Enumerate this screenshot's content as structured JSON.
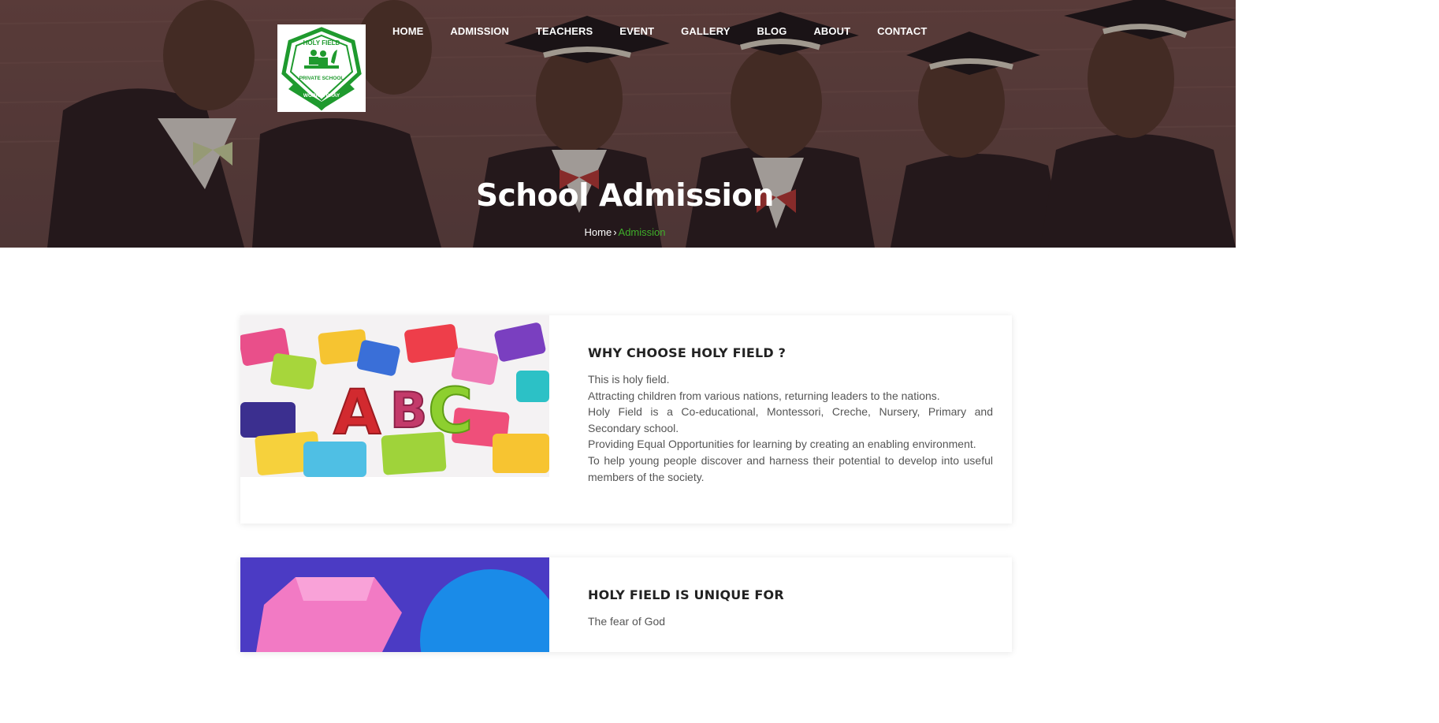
{
  "nav": {
    "items": [
      {
        "label": "HOME"
      },
      {
        "label": "ADMISSION"
      },
      {
        "label": "TEACHERS"
      },
      {
        "label": "EVENT"
      },
      {
        "label": "GALLERY"
      },
      {
        "label": "BLOG"
      },
      {
        "label": "ABOUT"
      },
      {
        "label": "CONTACT"
      }
    ]
  },
  "logo": {
    "top_text": "HOLY FIELD",
    "middle_text": "PRIVATE SCHOOL",
    "motto": "WORK & PRAY",
    "color": "#1f9a2e"
  },
  "hero": {
    "title": "School Admission",
    "breadcrumb": {
      "home": "Home",
      "separator": "›",
      "current": "Admission"
    }
  },
  "cards": [
    {
      "heading": "WHY CHOOSE HOLY FIELD ?",
      "lines": [
        "This is holy field.",
        "Attracting children from various nations, returning leaders to the nations.",
        "Holy Field is a Co-educational, Montessori, Creche, Nursery, Primary and Secondary school.",
        "Providing Equal Opportunities for learning by creating an enabling environment.",
        "To help young people discover and harness their potential to develop into useful members of the society."
      ]
    },
    {
      "heading": "HOLY FIELD IS UNIQUE FOR",
      "lines": [
        "The fear of God"
      ]
    }
  ],
  "colors": {
    "accent": "#3fae2a",
    "heading": "#222222",
    "body_text": "#555555"
  }
}
